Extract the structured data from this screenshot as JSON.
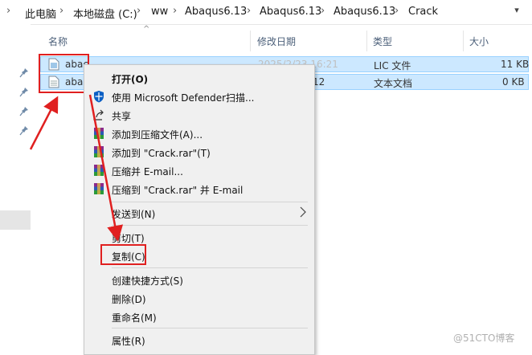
{
  "address_bar": {
    "crumbs": [
      "此电脑",
      "本地磁盘 (C:)",
      "ww",
      "Abaqus6.13",
      "Abaqus6.13",
      "Abaqus6.13",
      "Crack"
    ],
    "separator": "›",
    "dropdown": "▾"
  },
  "columns": {
    "name": "名称",
    "modified": "修改日期",
    "type": "类型",
    "size": "大小"
  },
  "files": [
    {
      "name": "abac",
      "modified": "2025/2/23 16:21",
      "type": "LIC 文件",
      "size": "11 KB",
      "icon": "lic-file-icon"
    },
    {
      "name": "abac",
      "modified": "12",
      "type": "文本文档",
      "size": "0 KB",
      "icon": "text-file-icon"
    }
  ],
  "context_menu": {
    "open": "打开(O)",
    "defender": "使用 Microsoft Defender扫描...",
    "share": "共享",
    "add_archive": "添加到压缩文件(A)...",
    "add_rar": "添加到 \"Crack.rar\"(T)",
    "compress_email": "压缩并 E-mail...",
    "compress_rar_email": "压缩到 \"Crack.rar\" 并 E-mail",
    "send_to": "发送到(N)",
    "cut": "剪切(T)",
    "copy": "复制(C)",
    "create_shortcut": "创建快捷方式(S)",
    "delete": "删除(D)",
    "rename": "重命名(M)",
    "properties": "属性(R)"
  },
  "watermark": "@51CTO博客",
  "colors": {
    "selection": "#cce8ff",
    "selection_border": "#99d1ff",
    "annotation": "#e02020",
    "menu_bg": "#f0f0f0"
  }
}
